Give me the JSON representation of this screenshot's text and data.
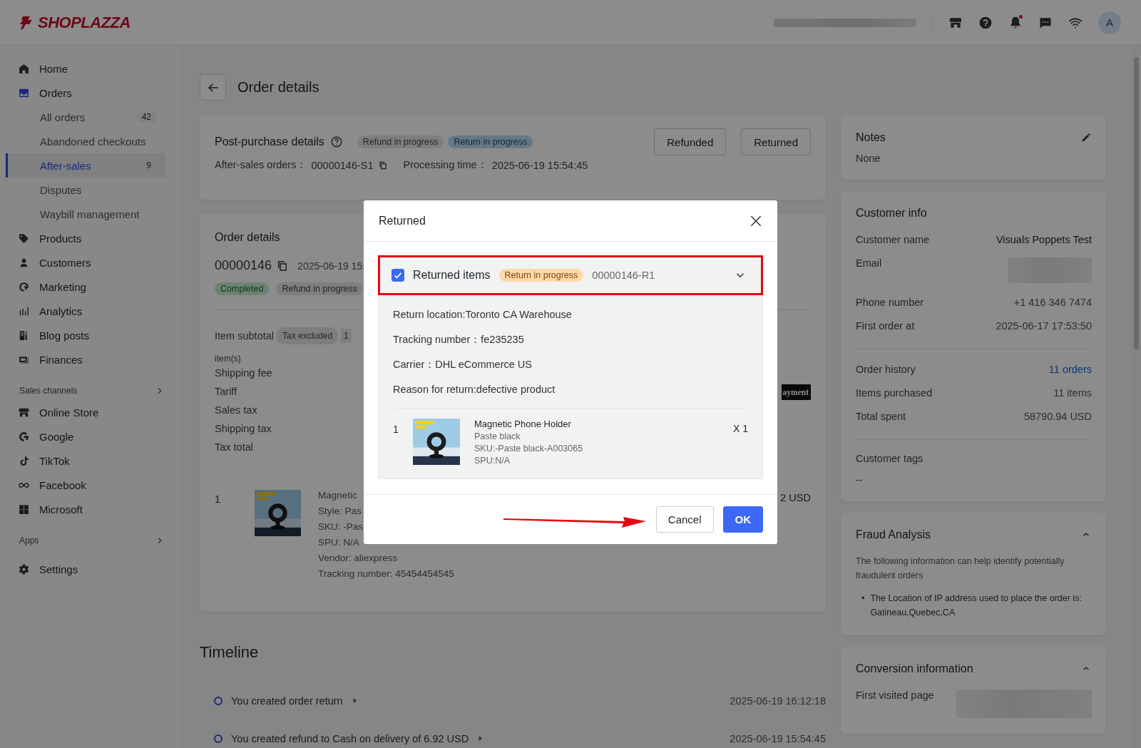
{
  "header": {
    "logo": "SHOPLAZZA",
    "avatar": "A",
    "notification": true
  },
  "sidebar": {
    "groups": [
      {
        "items": [
          {
            "label": "Home",
            "kind": "home"
          },
          {
            "label": "Orders",
            "kind": "orders",
            "expanded": true,
            "children": [
              {
                "label": "All orders",
                "badge": "42",
                "selected": false
              },
              {
                "label": "Abandoned checkouts",
                "selected": false
              },
              {
                "label": "After-sales",
                "badge": "9",
                "selected": true
              },
              {
                "label": "Disputes",
                "selected": false
              },
              {
                "label": "Waybill management",
                "selected": false
              }
            ]
          },
          {
            "label": "Products",
            "kind": "products"
          },
          {
            "label": "Customers",
            "kind": "customers"
          },
          {
            "label": "Marketing",
            "kind": "marketing"
          },
          {
            "label": "Analytics",
            "kind": "analytics"
          },
          {
            "label": "Blog posts",
            "kind": "blog"
          },
          {
            "label": "Finances",
            "kind": "finances"
          }
        ]
      },
      {
        "title": "Sales channels",
        "items": [
          {
            "label": "Online Store",
            "kind": "store"
          },
          {
            "label": "Google",
            "kind": "google"
          },
          {
            "label": "TikTok",
            "kind": "tiktok"
          },
          {
            "label": "Facebook",
            "kind": "facebook"
          },
          {
            "label": "Microsoft",
            "kind": "microsoft"
          }
        ]
      },
      {
        "title": "Apps"
      },
      {
        "items": [
          {
            "label": "Settings",
            "kind": "settings"
          }
        ]
      }
    ]
  },
  "page_title": "Order details",
  "post_purchase": {
    "title": "Post-purchase details",
    "tags": [
      {
        "label": "Refund in progress",
        "kind": "grey"
      },
      {
        "label": "Return in progress",
        "kind": "blue"
      }
    ],
    "buttons": [
      "Refunded",
      "Returned"
    ],
    "fields": [
      {
        "label": "After-sales orders：",
        "value": "00000146-S1",
        "copy": true
      },
      {
        "label": "Processing time：",
        "value": "2025-06-19 15:54:45",
        "copy": false
      }
    ]
  },
  "order": {
    "title": "Order details",
    "number": "00000146",
    "date": "2025-06-19 15:",
    "tags": [
      {
        "label": "Completed",
        "kind": "green"
      },
      {
        "label": "Refund in progress",
        "kind": "grey"
      }
    ],
    "summary": [
      {
        "label": "Item subtotal",
        "tag": "Tax excluded",
        "count": "1",
        "unit": "item(s)"
      },
      {
        "label": "Shipping fee"
      },
      {
        "label": "Tariff",
        "badge": "ayment"
      },
      {
        "label": "Sales tax"
      },
      {
        "label": "Shipping tax"
      },
      {
        "label": "Tax total"
      }
    ],
    "item": {
      "index": "1",
      "name": "Magnetic",
      "lines": [
        "Style: Pas",
        "SKU: -Pas",
        "SPU: N/A",
        "Vendor: aliexpress",
        "Tracking number: 45454454545"
      ],
      "price": "2 USD"
    }
  },
  "timeline": {
    "title": "Timeline",
    "events": [
      {
        "text": "You created order return",
        "time": "2025-06-19 16:12:18"
      },
      {
        "text": "You created refund to Cash on delivery of 6.92 USD",
        "time": "2025-06-19 15:54:45"
      }
    ]
  },
  "notes": {
    "title": "Notes",
    "body": "None"
  },
  "customer": {
    "title": "Customer info",
    "groups": [
      [
        {
          "label": "Customer name",
          "value": "Visuals Poppets Test",
          "kind": "strong"
        },
        {
          "label": "Email",
          "kind": "blurred"
        },
        {
          "label": "Phone number",
          "value": "+1 416 346 7474",
          "kind": "plain"
        },
        {
          "label": "First order at",
          "value": "2025-06-17 17:53:50",
          "kind": "plain"
        }
      ],
      [
        {
          "label": "Order history",
          "value": "11 orders",
          "kind": "link"
        },
        {
          "label": "Items purchased",
          "value": "11 items",
          "kind": "plain"
        },
        {
          "label": "Total spent",
          "value": "58790.94 USD",
          "kind": "plain"
        }
      ]
    ],
    "tags_label": "Customer tags",
    "tags_value": "--"
  },
  "fraud": {
    "title": "Fraud Analysis",
    "expanded": true,
    "description": "The following information can help identify potentially fraudulent orders",
    "marker": "•",
    "bullets": [
      "The Location of IP address used to place the order is: Gatineau,Quebec,CA"
    ]
  },
  "conversion": {
    "title": "Conversion information",
    "expanded": true,
    "rows": [
      {
        "label": "First visited page",
        "kind": "blurred"
      }
    ]
  },
  "modal": {
    "title": "Returned",
    "section": {
      "checked": true,
      "highlighted": true,
      "title": "Returned items",
      "status": "Return in progress",
      "id": "00000146-R1",
      "expanded": true,
      "details": [
        "Return location:Toronto CA Warehouse",
        "Tracking number：fe235235",
        "Carrier：DHL eCommerce US",
        "Reason for return:defective product"
      ],
      "item": {
        "index": "1",
        "name": "Magnetic Phone Holder",
        "variant": "Paste black",
        "sku": "SKU:-Paste black-A003065",
        "spu": "SPU:N/A",
        "qty": "X 1"
      }
    },
    "buttons": [
      {
        "label": "Cancel",
        "kind": "secondary"
      },
      {
        "label": "OK",
        "kind": "primary"
      }
    ],
    "arrow": true
  }
}
